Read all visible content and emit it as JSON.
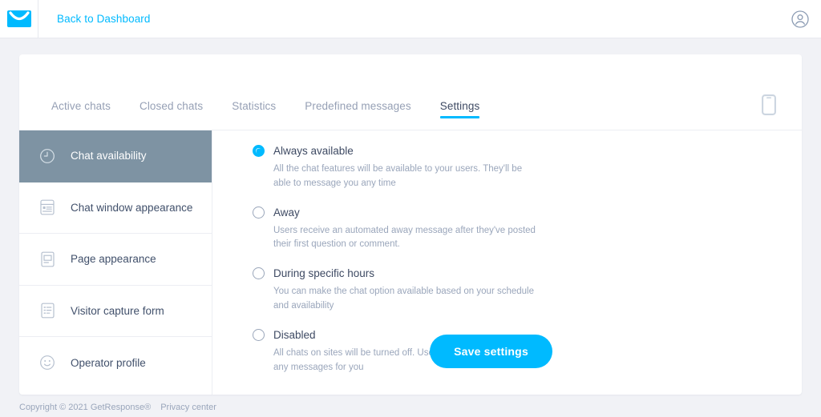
{
  "header": {
    "logo_icon": "envelope-logo-icon",
    "back_link": "Back to Dashboard",
    "account_icon": "user-account-icon"
  },
  "tabs": [
    {
      "label": "Active chats",
      "active": false
    },
    {
      "label": "Closed chats",
      "active": false
    },
    {
      "label": "Statistics",
      "active": false
    },
    {
      "label": "Predefined messages",
      "active": false
    },
    {
      "label": "Settings",
      "active": true
    }
  ],
  "preview_icon": "mobile-preview-icon",
  "sidebar": {
    "items": [
      {
        "label": "Chat availability",
        "icon": "clock-icon",
        "active": true
      },
      {
        "label": "Chat window appearance",
        "icon": "chat-window-icon",
        "active": false
      },
      {
        "label": "Page appearance",
        "icon": "page-document-icon",
        "active": false
      },
      {
        "label": "Visitor capture form",
        "icon": "form-list-icon",
        "active": false
      },
      {
        "label": "Operator profile",
        "icon": "smiley-face-icon",
        "active": false
      }
    ]
  },
  "settings": {
    "options": [
      {
        "label": "Always available",
        "description": "All the chat features will be available to your users. They'll be able to message you any time",
        "selected": true
      },
      {
        "label": "Away",
        "description": "Users receive an automated away message after they've posted their first question or comment.",
        "selected": false
      },
      {
        "label": "During specific hours",
        "description": "You can make the chat option available based on your schedule and availability",
        "selected": false
      },
      {
        "label": "Disabled",
        "description": "All chats on sites will be turned off. Users won't be able to leave any messages for you",
        "selected": false
      }
    ],
    "save_label": "Save settings"
  },
  "footer": {
    "copyright": "Copyright © 2021 GetResponse®",
    "privacy_link": "Privacy center"
  },
  "colors": {
    "accent": "#00baff",
    "sidebar_active_bg": "#7e93a3",
    "page_bg": "#f1f2f6",
    "text": "#3e4a63",
    "muted": "#9aa6bb"
  }
}
